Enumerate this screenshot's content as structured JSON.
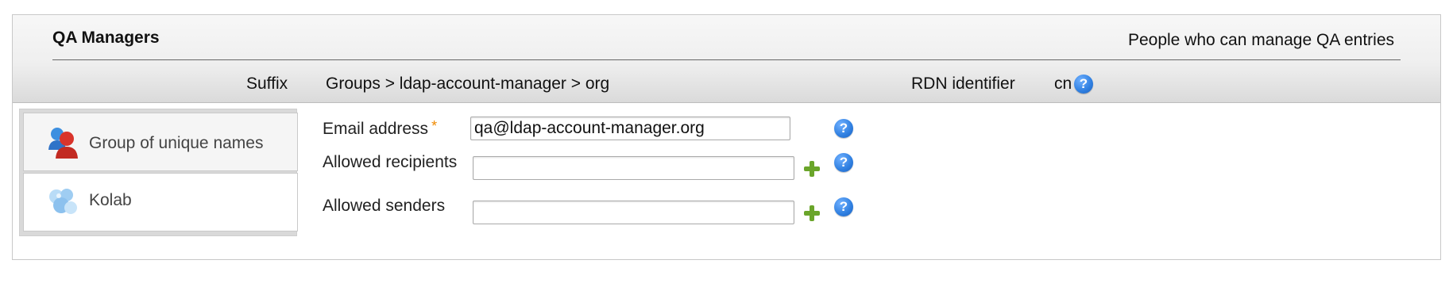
{
  "header": {
    "title": "QA Managers",
    "description": "People who can manage QA entries",
    "suffix_label": "Suffix",
    "suffix_value": "Groups > ldap-account-manager > org",
    "rdn_label": "RDN identifier",
    "rdn_value": "cn"
  },
  "tabs": [
    {
      "label": "Group of unique names",
      "icon": "group-users-icon"
    },
    {
      "label": "Kolab",
      "icon": "kolab-icon"
    }
  ],
  "form": {
    "email": {
      "label": "Email address",
      "required_marker": "*",
      "value": "qa@ldap-account-manager.org"
    },
    "allowed_recipients": {
      "label": "Allowed recipients",
      "value": ""
    },
    "allowed_senders": {
      "label": "Allowed senders",
      "value": ""
    }
  },
  "help_glyph": "?",
  "colors": {
    "accent_help": "#2f7fe0",
    "add_green": "#6aa52a",
    "required": "#f08a00"
  }
}
